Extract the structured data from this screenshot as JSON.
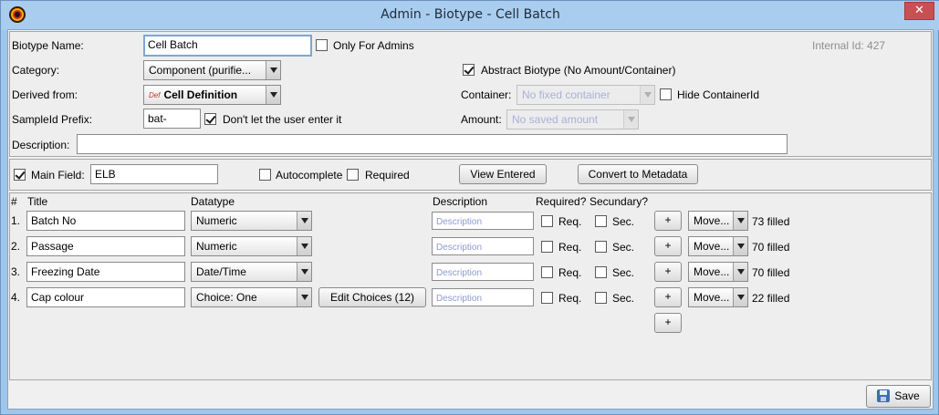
{
  "window": {
    "title": "Admin - Biotype - Cell Batch",
    "close_glyph": "✕"
  },
  "biotype": {
    "name_label": "Biotype Name:",
    "name_value": "Cell Batch",
    "only_admins_label": "Only For Admins",
    "only_admins_checked": false,
    "internal_id": "Internal Id: 427",
    "category_label": "Category:",
    "category_value": "Component (purifie...",
    "abstract_label": "Abstract Biotype (No Amount/Container)",
    "abstract_checked": true,
    "derived_label": "Derived from:",
    "derived_badge": "Def",
    "derived_value": "Cell Definition",
    "container_label": "Container:",
    "container_value": "No fixed container",
    "hide_container_label": "Hide ContainerId",
    "hide_container_checked": false,
    "prefix_label": "SampleId Prefix:",
    "prefix_value": "bat-",
    "no_user_enter_label": "Don't let the user enter it",
    "no_user_enter_checked": true,
    "amount_label": "Amount:",
    "amount_value": "No saved amount",
    "description_label": "Description:",
    "description_value": ""
  },
  "main_field": {
    "checked": true,
    "label": "Main Field:",
    "value": "ELB",
    "autocomplete_label": "Autocomplete",
    "required_label": "Required",
    "view_entered_label": "View Entered",
    "convert_label": "Convert to Metadata"
  },
  "fields_table": {
    "headers": {
      "num": "#",
      "title": "Title",
      "datatype": "Datatype",
      "description": "Description",
      "required": "Required?",
      "secundary": "Secundary?"
    },
    "description_placeholder": "Description",
    "req_label": "Req.",
    "sec_label": "Sec.",
    "plus_label": "+",
    "move_label": "Move...",
    "rows": [
      {
        "num": "1.",
        "title": "Batch No",
        "datatype": "Numeric",
        "filled": "73 filled"
      },
      {
        "num": "2.",
        "title": "Passage",
        "datatype": "Numeric",
        "filled": "70 filled"
      },
      {
        "num": "3.",
        "title": "Freezing Date",
        "datatype": "Date/Time",
        "filled": "70 filled"
      },
      {
        "num": "4.",
        "title": "Cap colour",
        "datatype": "Choice: One",
        "edit_choices": "Edit Choices (12)",
        "filled": "22 filled"
      }
    ]
  },
  "footer": {
    "save_label": "Save"
  }
}
